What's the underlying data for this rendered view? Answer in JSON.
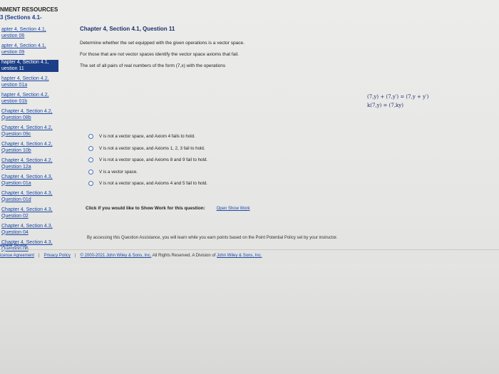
{
  "sidebar": {
    "header": "NMENT RESOURCES",
    "subheader": "3 (Sections 4.1-",
    "items": [
      {
        "line1": "apter 4, Section 4.1,",
        "line2": "uestion 06",
        "active": false
      },
      {
        "line1": "apter 4, Section 4.1,",
        "line2": "uestion 09",
        "active": false
      },
      {
        "line1": "hapter 4, Section 4.1,",
        "line2": "uestion 11",
        "active": true
      },
      {
        "line1": "hapter 4, Section 4.2,",
        "line2": "uestion 01a",
        "active": false
      },
      {
        "line1": "hapter 4, Section 4.2,",
        "line2": "uestion 01b",
        "active": false
      },
      {
        "line1": "Chapter 4, Section 4.2,",
        "line2": "Question 08b",
        "active": false
      },
      {
        "line1": "Chapter 4, Section 4.2,",
        "line2": "Question 09c",
        "active": false
      },
      {
        "line1": "Chapter 4, Section 4.2,",
        "line2": "Question 10b",
        "active": false
      },
      {
        "line1": "Chapter 4, Section 4.2,",
        "line2": "Question 12a",
        "active": false
      },
      {
        "line1": "Chapter 4, Section 4.3,",
        "line2": "Question 01a",
        "active": false
      },
      {
        "line1": "Chapter 4, Section 4.3,",
        "line2": "Question 01d",
        "active": false
      },
      {
        "line1": "Chapter 4, Section 4.3,",
        "line2": "Question 02",
        "active": false
      },
      {
        "line1": "Chapter 4, Section 4.3,",
        "line2": "Question 04",
        "active": false
      },
      {
        "line1": "Chapter 4, Section 4.3,",
        "line2": "Question 06",
        "active": false
      }
    ]
  },
  "question": {
    "title": "Chapter 4, Section 4.1, Question 11",
    "p1": "Determine whether the set equipped with the given operations is a vector space.",
    "p2": "For those that are not vector spaces identify the vector space axioms that fail.",
    "p3": "The set of all pairs of real numbers of the form (7,x) with the operations",
    "formula1": "(7,y) + (7,y′) = (7,y + y′)",
    "formula2": "k(7,y) = (7,ky)"
  },
  "options": [
    "V is not a vector space, and Axiom 4 fails to hold.",
    "V is not a vector space, and Axioms 1, 2, 3 fail to hold.",
    "V is not a vector space, and Axioms 8 and 9 fail to hold.",
    "V is a vector space.",
    "V is not a vector space, and Axioms 4 and 5 fail to hold."
  ],
  "showwork": {
    "prompt": "Click if you would like to Show Work for this question:",
    "link": "Open Show Work"
  },
  "assistance": "By accessing this Question Assistance, you will learn while you earn points based on the Point Potential Policy set by your instructor.",
  "footer": {
    "score": "eview Score",
    "license": "icense Agreement",
    "privacy": "Privacy Policy",
    "copyright": "© 2000-2021 John Wiley & Sons, Inc.",
    "rights": "All Rights Reserved. A Division of",
    "division": "John Wiley & Sons, Inc."
  }
}
